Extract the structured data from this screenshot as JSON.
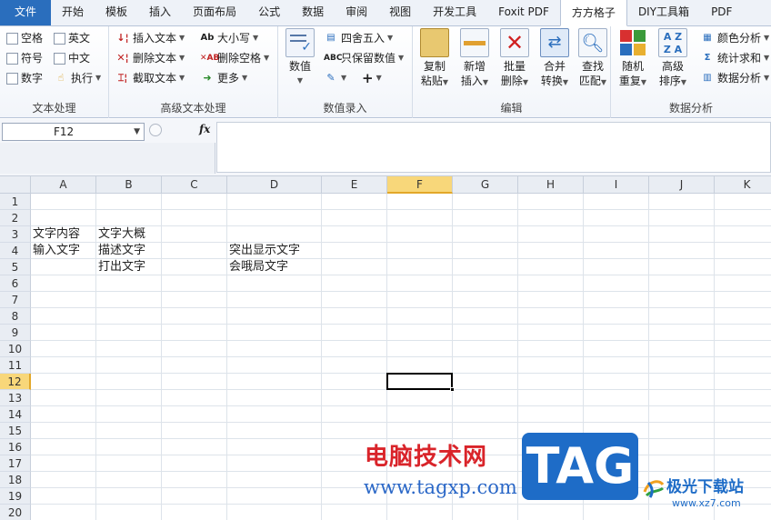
{
  "tabs": [
    {
      "label": "文件",
      "kind": "file"
    },
    {
      "label": "开始"
    },
    {
      "label": "模板"
    },
    {
      "label": "插入"
    },
    {
      "label": "页面布局"
    },
    {
      "label": "公式"
    },
    {
      "label": "数据"
    },
    {
      "label": "审阅"
    },
    {
      "label": "视图"
    },
    {
      "label": "开发工具"
    },
    {
      "label": "Foxit PDF"
    },
    {
      "label": "方方格子",
      "active": true
    },
    {
      "label": "DIY工具箱"
    },
    {
      "label": "PDF"
    }
  ],
  "ribbon": {
    "text_group": {
      "label": "文本处理",
      "checkboxes": [
        "空格",
        "英文",
        "符号",
        "中文",
        "数字"
      ],
      "execute": "执行"
    },
    "advanced_group": {
      "label": "高级文本处理",
      "insert_text": "插入文本",
      "delete_text": "删除文本",
      "extract_text": "截取文本",
      "case": "大小写",
      "delete_space": "删除空格",
      "more": "更多"
    },
    "entry_group": {
      "label": "数值录入",
      "value_btn": "数值",
      "round": "四舍五入",
      "keep_value": "只保留数值",
      "plus": "+"
    },
    "edit_group": {
      "label": "编辑",
      "buttons": [
        {
          "line1": "复制",
          "line2": "粘贴"
        },
        {
          "line1": "新增",
          "line2": "插入"
        },
        {
          "line1": "批量",
          "line2": "删除"
        },
        {
          "line1": "合并",
          "line2": "转换"
        },
        {
          "line1": "查找",
          "line2": "匹配"
        }
      ]
    },
    "analysis_group": {
      "label": "数据分析",
      "random": {
        "line1": "随机",
        "line2": "重复"
      },
      "sort": {
        "line1": "高级",
        "line2": "排序"
      },
      "color_analysis": "颜色分析",
      "stat_sum": "统计求和",
      "data_analysis": "数据分析"
    }
  },
  "formula_bar": {
    "name_box": "F12",
    "fx": "fx",
    "formula": ""
  },
  "sheet": {
    "columns": [
      "A",
      "B",
      "C",
      "D",
      "E",
      "F",
      "G",
      "H",
      "I",
      "J",
      "K"
    ],
    "selected_column": "F",
    "rows": [
      "1",
      "2",
      "3",
      "4",
      "5",
      "6",
      "7",
      "8",
      "9",
      "10",
      "11",
      "12",
      "13",
      "14",
      "15",
      "16",
      "17",
      "18",
      "19",
      "20"
    ],
    "selected_row": "12",
    "cells": {
      "A3": "文字内容",
      "B3": "文字大概",
      "A4": "输入文字",
      "B4": "描述文字",
      "D4": "突出显示文字",
      "B5": "打出文字",
      "D5": "会哦局文字"
    }
  },
  "watermark": {
    "red_text": "电脑技术网",
    "url": "www.tagxp.com",
    "tag": "TAG",
    "logo_title": "极光下载站",
    "logo_url": "www.xz7.com"
  },
  "colors": {
    "file_tab": "#2a6ebd",
    "selection_header": "#f8d77a",
    "watermark_red": "#d9242a",
    "watermark_blue": "#1e6cc7"
  }
}
